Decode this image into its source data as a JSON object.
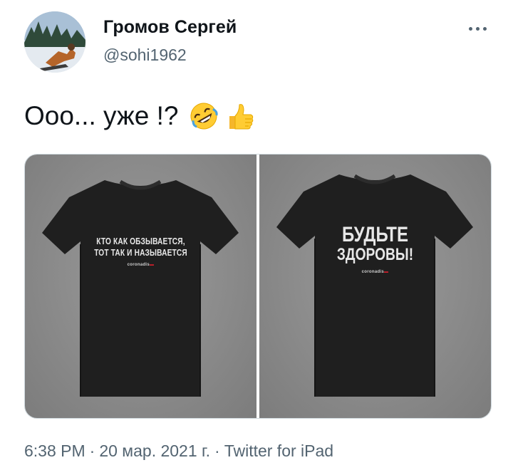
{
  "author": {
    "name": "Громов Сергей",
    "handle": "@sohi1962"
  },
  "tweet": {
    "text": "Ооо... уже !?",
    "emojis": [
      "rolling-on-floor-laughing-emoji",
      "thumbs-up-emoji"
    ]
  },
  "media": [
    {
      "shirt_line1": "КТО КАК ОБЗЫВАЕТСЯ,",
      "shirt_line2": "ТОТ ТАК И НАЗЫВАЕТСЯ"
    },
    {
      "shirt_line1": "БУДЬТЕ",
      "shirt_line2": "ЗДОРОВЫ!"
    }
  ],
  "meta": {
    "time": "6:38 PM",
    "date": "20 мар. 2021 г.",
    "source": "Twitter for iPad",
    "separator": "·"
  },
  "colors": {
    "text": "#0f1419",
    "secondary": "#536471",
    "shirt": "#1e1e1e",
    "photo_bg": "#8a8a8a",
    "emoji_yellow": "#ffcc33"
  }
}
